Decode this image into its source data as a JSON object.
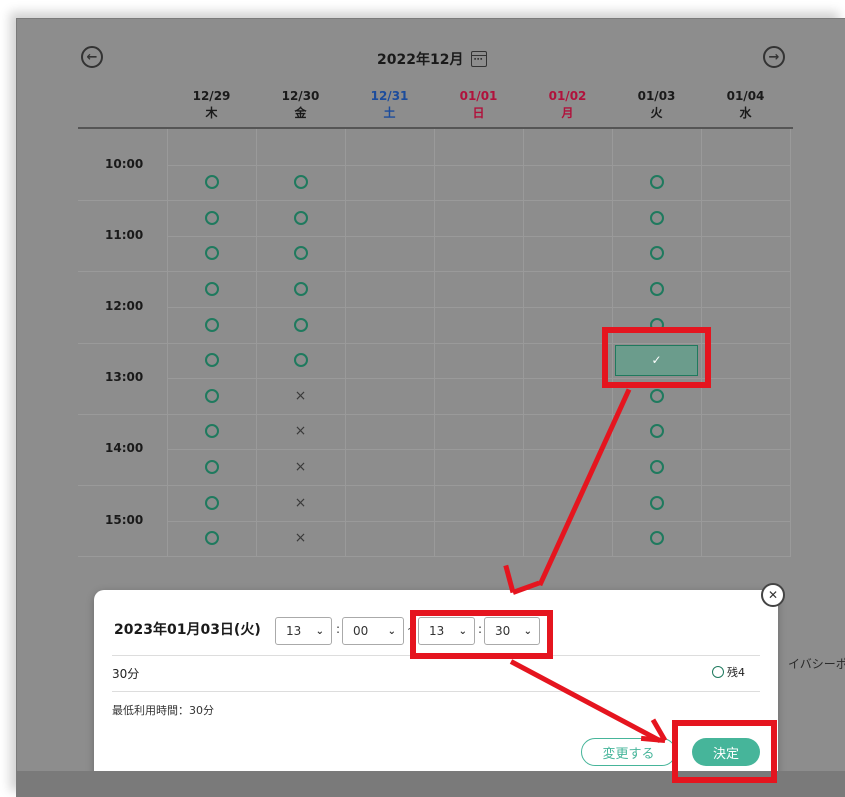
{
  "calendar": {
    "month_title": "2022年12月",
    "prev_icon": "arrow-left-circle-icon",
    "next_icon": "arrow-right-circle-icon",
    "days": [
      {
        "date": "12/29",
        "dow": "木",
        "color": "normal"
      },
      {
        "date": "12/30",
        "dow": "金",
        "color": "normal"
      },
      {
        "date": "12/31",
        "dow": "土",
        "color": "blue"
      },
      {
        "date": "01/01",
        "dow": "日",
        "color": "red"
      },
      {
        "date": "01/02",
        "dow": "月",
        "color": "red"
      },
      {
        "date": "01/03",
        "dow": "火",
        "color": "normal"
      },
      {
        "date": "01/04",
        "dow": "水",
        "color": "normal"
      }
    ],
    "times": [
      "10:00",
      "11:00",
      "12:00",
      "13:00",
      "14:00",
      "15:00"
    ],
    "slots": [
      [
        "",
        "",
        "",
        "",
        "",
        "",
        ""
      ],
      [
        "o",
        "o",
        "",
        "",
        "",
        "o",
        ""
      ],
      [
        "o",
        "o",
        "",
        "",
        "",
        "o",
        ""
      ],
      [
        "o",
        "o",
        "",
        "",
        "",
        "o",
        ""
      ],
      [
        "o",
        "o",
        "",
        "",
        "",
        "o",
        ""
      ],
      [
        "o",
        "o",
        "",
        "",
        "",
        "o",
        ""
      ],
      [
        "o",
        "o",
        "",
        "",
        "",
        "selected",
        ""
      ],
      [
        "o",
        "x",
        "",
        "",
        "",
        "o",
        ""
      ],
      [
        "o",
        "x",
        "",
        "",
        "",
        "o",
        ""
      ],
      [
        "o",
        "x",
        "",
        "",
        "",
        "o",
        ""
      ],
      [
        "o",
        "x",
        "",
        "",
        "",
        "o",
        ""
      ],
      [
        "o",
        "x",
        "",
        "",
        "",
        "o",
        ""
      ]
    ],
    "slot_symbols": {
      "o": "○",
      "x": "×",
      "selected": "✓"
    }
  },
  "dialog": {
    "date": "2023年01月03日(火)",
    "start_hour": "13",
    "start_minute": "00",
    "end_hour": "13",
    "end_minute": "30",
    "colon": ":",
    "tilde": "~",
    "duration": "30分",
    "remaining": "残4",
    "min_use": "最低利用時間：30分",
    "change_button": "変更する",
    "confirm_button": "決定",
    "close_icon": "close-circle-icon"
  },
  "background_text": "イバシーポリ",
  "colors": {
    "accent": "#46b59a",
    "slot_green": "#1f7a5e",
    "highlight_red": "#e5151f",
    "saturday_blue": "#1c4c9c",
    "holiday_red": "#b0123c"
  }
}
